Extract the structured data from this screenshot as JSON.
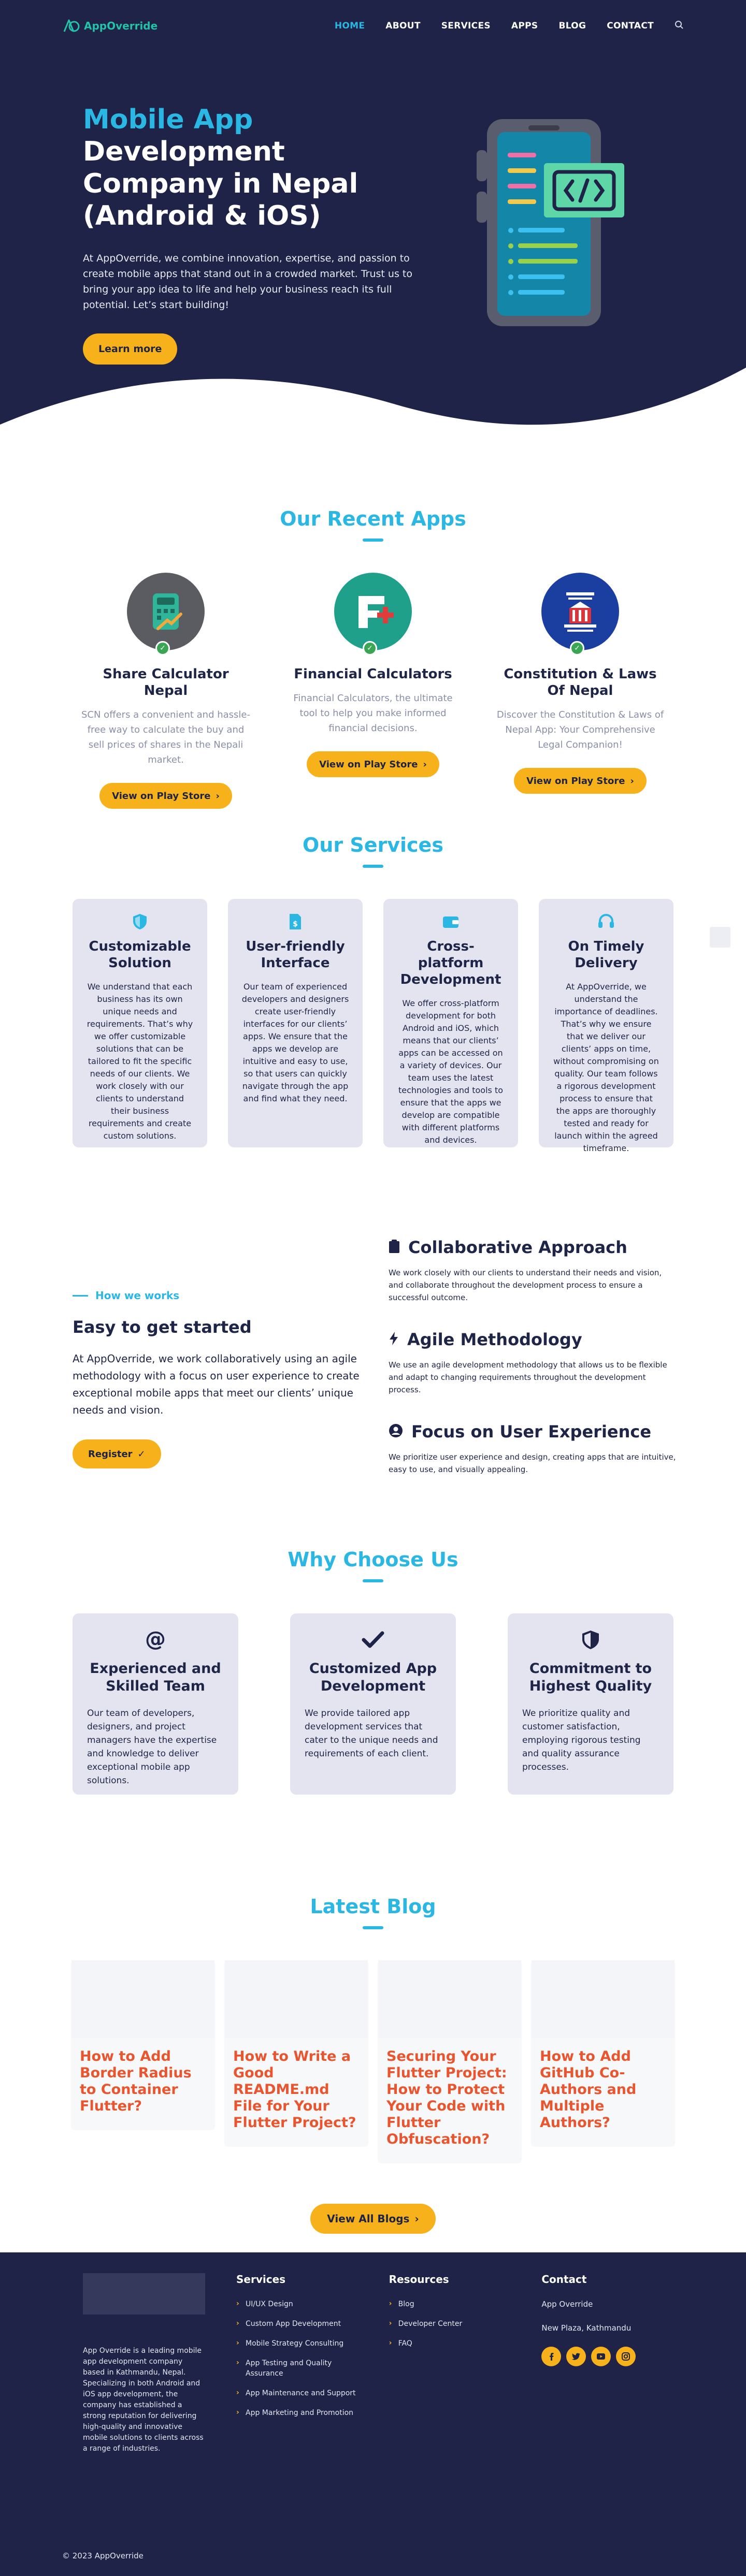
{
  "brand": {
    "name": "AppOverride"
  },
  "nav": {
    "items": [
      "HOME",
      "ABOUT",
      "SERVICES",
      "APPS",
      "BLOG",
      "CONTACT"
    ],
    "active": "HOME",
    "search_icon": "search-icon"
  },
  "hero": {
    "title_highlight": "Mobile App",
    "title_rest": "Development Company in Nepal (Android & iOS)",
    "description": "At AppOverride, we combine innovation, expertise, and passion to create mobile apps that stand out in a crowded market. Trust us to bring your app idea to life and help your business reach its full potential. Let’s start building!",
    "cta": "Learn more"
  },
  "apps": {
    "title": "Our Recent Apps",
    "items": [
      {
        "title": "Share Calculator Nepal",
        "description": "SCN offers a convenient and hassle-free way to calculate the buy and sell prices of shares in the Nepali market.",
        "button": "View on Play Store"
      },
      {
        "title": "Financial Calculators",
        "description": "Financial Calculators, the ultimate tool to help you make informed financial decisions.",
        "button": "View on Play Store"
      },
      {
        "title": "Constitution & Laws Of Nepal",
        "description": "Discover the Constitution & Laws of Nepal App: Your Comprehensive Legal Companion!",
        "button": "View on Play Store"
      }
    ]
  },
  "services": {
    "title": "Our Services",
    "items": [
      {
        "icon": "shield-icon",
        "title": "Customizable Solution",
        "description": "We understand that each business has its own unique needs and requirements. That’s why we offer customizable solutions that can be tailored to fit the specific needs of our clients. We work closely with our clients to understand their business requirements and create custom solutions."
      },
      {
        "icon": "invoice-dollar-icon",
        "title": "User-friendly Interface",
        "description": "Our team of experienced developers and designers create user-friendly interfaces for our clients’ apps. We ensure that the apps we develop are intuitive and easy to use, so that users can quickly navigate through the app and find what they need."
      },
      {
        "icon": "wallet-icon",
        "title": "Cross-platform Development",
        "description": "We offer cross-platform development for both Android and iOS, which means that our clients’ apps can be accessed on a variety of devices. Our team uses the latest technologies and tools to ensure that the apps we develop are compatible with different platforms and devices."
      },
      {
        "icon": "headset-icon",
        "title": "On Timely Delivery",
        "description": "At AppOverride, we understand the importance of deadlines. That’s why we ensure that we deliver our clients’ apps on time, without compromising on quality. Our team follows a rigorous development process to ensure that the apps are thoroughly tested and ready for launch within the agreed timeframe."
      }
    ]
  },
  "how": {
    "kicker": "How we works",
    "title": "Easy to get started",
    "description": "At AppOverride, we work collaboratively using an agile methodology with a focus on user experience to create exceptional mobile apps that meet our clients’ unique needs and vision.",
    "cta": "Register",
    "features": [
      {
        "icon": "clipboard-icon",
        "title": "Collaborative Approach",
        "description": "We work closely with our clients to understand their needs and vision, and collaborate throughout the development process to ensure a successful outcome."
      },
      {
        "icon": "bolt-icon",
        "title": "Agile Methodology",
        "description": "We use an agile development methodology that allows us to be flexible and adapt to changing requirements throughout the development process."
      },
      {
        "icon": "user-circle-icon",
        "title": "Focus on User Experience",
        "description": "We prioritize user experience and design, creating apps that are intuitive, easy to use, and visually appealing."
      }
    ]
  },
  "why": {
    "title": "Why Choose Us",
    "items": [
      {
        "icon": "at-icon",
        "title": "Experienced and Skilled Team",
        "description": "Our team of developers, designers, and project managers have the expertise and knowledge to deliver exceptional mobile app solutions."
      },
      {
        "icon": "check-icon",
        "title": "Customized App Development",
        "description": "We provide tailored app development services that cater to the unique needs and requirements of each client."
      },
      {
        "icon": "shield-half-icon",
        "title": "Commitment to Highest Quality",
        "description": "We prioritize quality and customer satisfaction, employing rigorous testing and quality assurance processes."
      }
    ]
  },
  "blog": {
    "title": "Latest Blog",
    "posts": [
      "How to Add Border Radius to Container Flutter?",
      "How to Write a Good README.md File for Your Flutter Project?",
      "Securing Your Flutter Project: How to Protect Your Code with Flutter Obfuscation?",
      "How to Add GitHub Co-Authors and Multiple Authors?"
    ],
    "cta": "View All Blogs"
  },
  "footer": {
    "about": "App Override is a leading mobile app development company based in Kathmandu, Nepal. Specializing in both Android and iOS app development, the company has established a strong reputation for delivering high-quality and innovative mobile solutions to clients across a range of industries.",
    "services_title": "Services",
    "services": [
      "UI/UX Design",
      "Custom App Development",
      "Mobile Strategy Consulting",
      "App Testing and Quality Assurance",
      "App Maintenance and Support",
      "App Marketing and Promotion"
    ],
    "resources_title": "Resources",
    "resources": [
      "Blog",
      "Developer Center",
      "FAQ"
    ],
    "contact_title": "Contact",
    "contact_name": "App Override",
    "contact_address": "New Plaza, Kathmandu",
    "socials": [
      "facebook-icon",
      "twitter-icon",
      "youtube-icon",
      "instagram-icon"
    ],
    "copyright": "© 2023 AppOverride"
  },
  "colors": {
    "navy": "#1e2347",
    "accent": "#2bb7e3",
    "yellow": "#f7b21b",
    "teal": "#22c3a6",
    "blog_title": "#e8552e"
  }
}
